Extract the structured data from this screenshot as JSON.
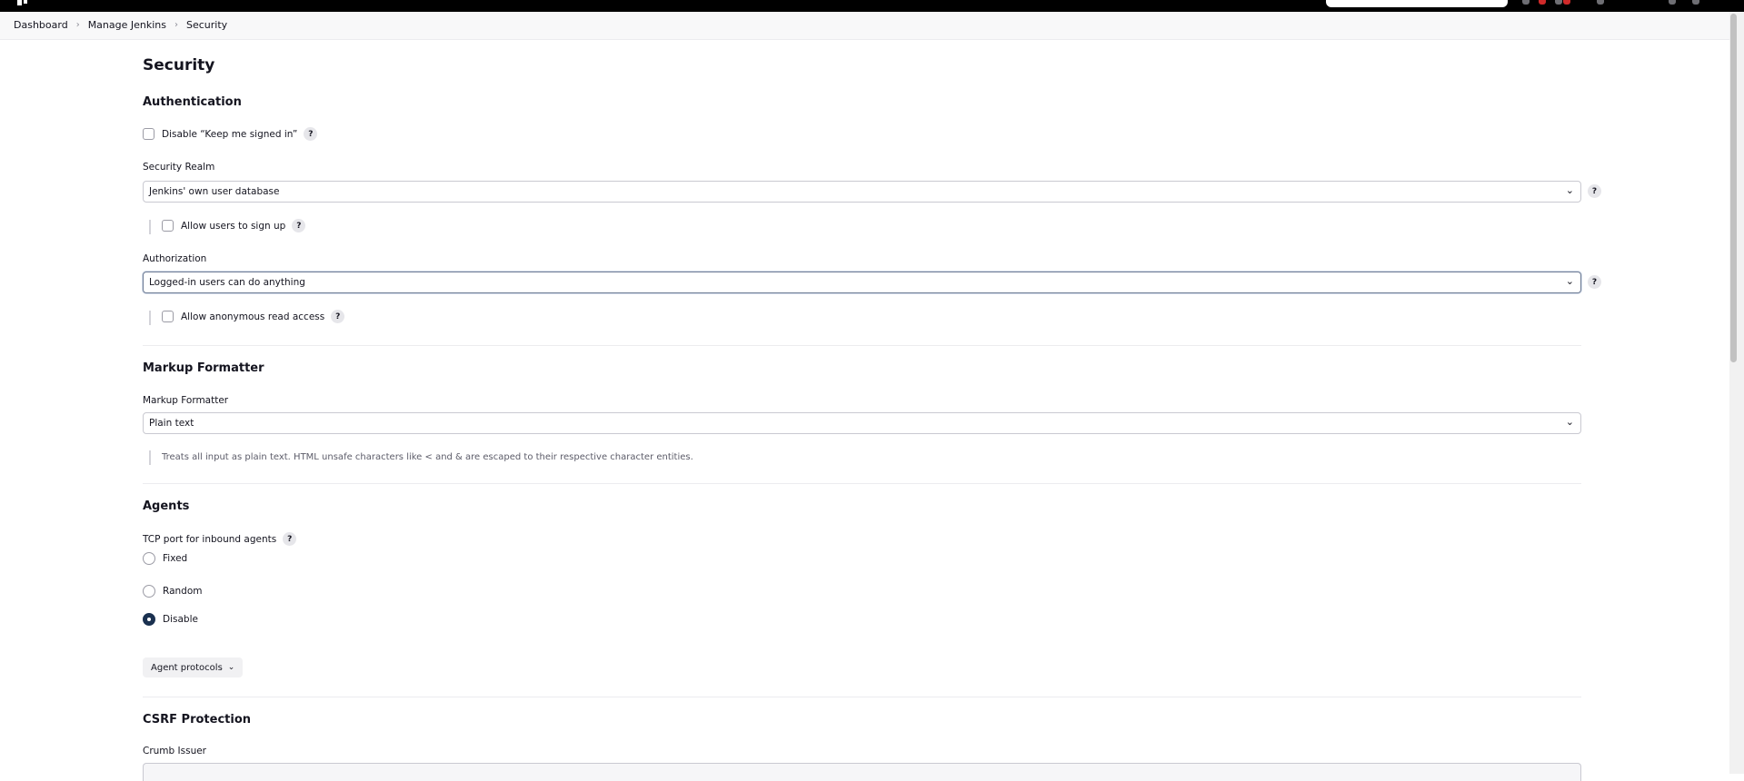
{
  "breadcrumb": {
    "items": [
      "Dashboard",
      "Manage Jenkins",
      "Security"
    ],
    "separator": "›"
  },
  "page": {
    "title": "Security"
  },
  "authentication": {
    "heading": "Authentication",
    "disable_keep_signed_in_label": "Disable “Keep me signed in”",
    "security_realm_label": "Security Realm",
    "security_realm_value": "Jenkins' own user database",
    "allow_signup_label": "Allow users to sign up",
    "authorization_label": "Authorization",
    "authorization_value": "Logged-in users can do anything",
    "allow_anonymous_label": "Allow anonymous read access"
  },
  "markup": {
    "heading": "Markup Formatter",
    "label": "Markup Formatter",
    "value": "Plain text",
    "description": "Treats all input as plain text. HTML unsafe characters like < and & are escaped to their respective character entities."
  },
  "agents": {
    "heading": "Agents",
    "tcp_port_label": "TCP port for inbound agents",
    "options": [
      "Fixed",
      "Random",
      "Disable"
    ],
    "selected": "Disable",
    "protocols_button": "Agent protocols"
  },
  "csrf": {
    "heading": "CSRF Protection",
    "crumb_issuer_label": "Crumb Issuer"
  },
  "help_glyph": "?",
  "chevron_glyph": "⌄",
  "icons": {
    "logo": "jenkins-logo-icon",
    "help": "help-icon",
    "chevron": "chevron-down-icon"
  },
  "colors": {
    "topbar": "#000000",
    "accent": "#1b3150"
  }
}
